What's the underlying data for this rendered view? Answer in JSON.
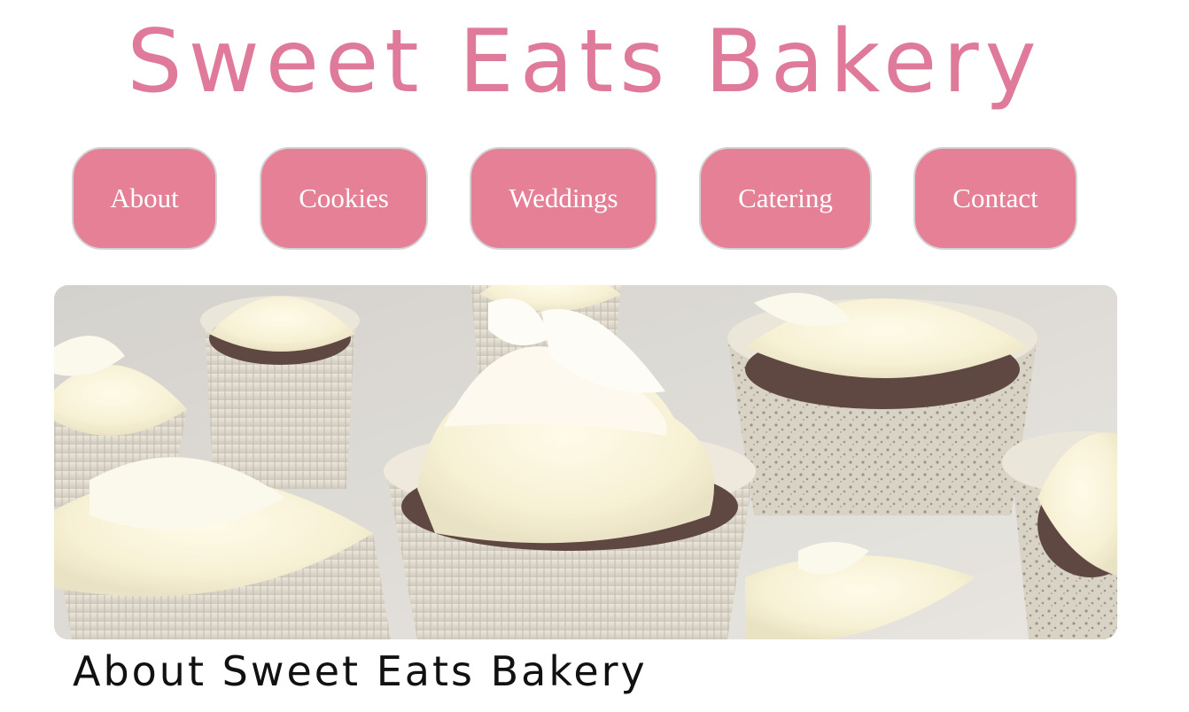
{
  "header": {
    "title": "Sweet Eats Bakery"
  },
  "nav": {
    "items": [
      {
        "label": "About"
      },
      {
        "label": "Cookies"
      },
      {
        "label": "Weddings"
      },
      {
        "label": "Catering"
      },
      {
        "label": "Contact"
      }
    ]
  },
  "hero": {
    "image_subject": "cupcakes-with-white-frosting"
  },
  "main": {
    "section_heading": "About Sweet Eats Bakery"
  },
  "colors": {
    "brand_pink": "#e07a9a",
    "button_pink": "#e68097",
    "button_text": "#ffffff",
    "heading_text": "#111111"
  }
}
